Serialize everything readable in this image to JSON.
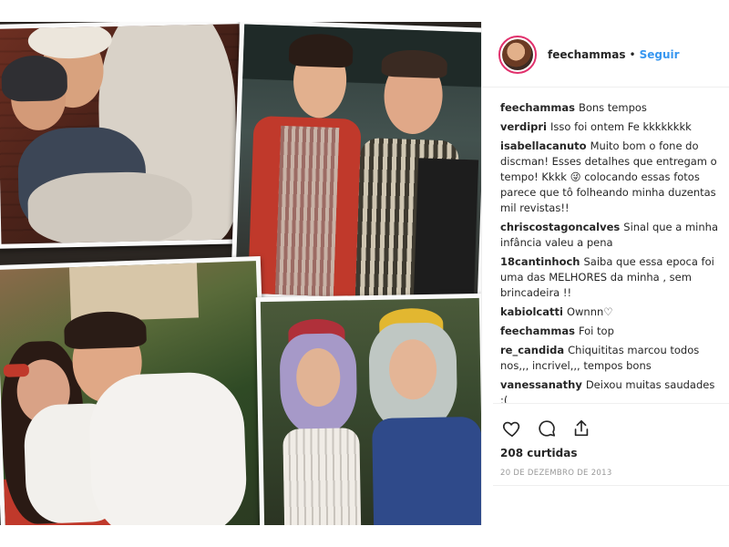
{
  "post": {
    "username": "feechammas",
    "separator": "•",
    "follow_label": "Seguir",
    "photo_alt": "Colagem de fotos"
  },
  "comments": [
    {
      "user": "feechammas",
      "text": "Bons tempos"
    },
    {
      "user": "verdipri",
      "text": "Isso foi ontem Fe kkkkkkkk"
    },
    {
      "user": "isabellacanuto",
      "text": "Muito bom o fone do discman! Esses detalhes que entregam o tempo! Kkkk 😜 colocando essas fotos parece que tô folheando minha duzentas mil revistas!!"
    },
    {
      "user": "chriscostagoncalves",
      "text": "Sinal que a minha infância valeu a pena"
    },
    {
      "user": "18cantinhoch",
      "text": "Saiba que essa epoca foi uma das MELHORES da minha , sem brincadeira !!"
    },
    {
      "user": "kabiolcatti",
      "text": "Ownnn♡"
    },
    {
      "user": "feechammas",
      "text": "Foi top"
    },
    {
      "user": "re_candida",
      "text": "Chiquititas marcou todos nos,,, incrivel,,, tempos bons"
    },
    {
      "user": "vanessanathy",
      "text": "Deixou muitas saudades :("
    }
  ],
  "actions": {
    "like_icon": "heart-icon",
    "comment_icon": "comment-icon",
    "share_icon": "share-icon"
  },
  "likes_label": "208 curtidas",
  "date_label": "20 DE DEZEMBRO DE 2013",
  "colors": {
    "link": "#3897f0",
    "text": "#262626",
    "muted": "#999999",
    "border": "#efefef"
  }
}
